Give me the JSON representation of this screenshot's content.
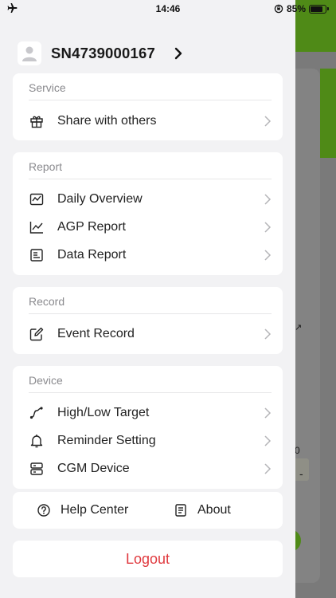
{
  "status_bar": {
    "time": "14:46",
    "battery": "85%",
    "battery_level": 0.85
  },
  "user": {
    "serial": "SN4739000167"
  },
  "sections": [
    {
      "title": "Service",
      "items": [
        {
          "label": "Share with others",
          "icon": "gift-icon"
        }
      ]
    },
    {
      "title": "Report",
      "items": [
        {
          "label": "Daily Overview",
          "icon": "daily-chart-icon"
        },
        {
          "label": "AGP Report",
          "icon": "line-chart-icon"
        },
        {
          "label": "Data Report",
          "icon": "document-icon"
        }
      ]
    },
    {
      "title": "Record",
      "items": [
        {
          "label": "Event Record",
          "icon": "edit-icon"
        }
      ]
    },
    {
      "title": "Device",
      "items": [
        {
          "label": "High/Low Target",
          "icon": "curve-icon"
        },
        {
          "label": "Reminder Setting",
          "icon": "bell-icon"
        },
        {
          "label": "CGM Device",
          "icon": "device-icon"
        }
      ]
    }
  ],
  "bottom": {
    "help": "Help Center",
    "about": "About"
  },
  "logout": "Logout",
  "background": {
    "number": "0",
    "dash": "-"
  },
  "colors": {
    "accent_green": "#4f8a17",
    "logout_red": "#e0393e"
  }
}
